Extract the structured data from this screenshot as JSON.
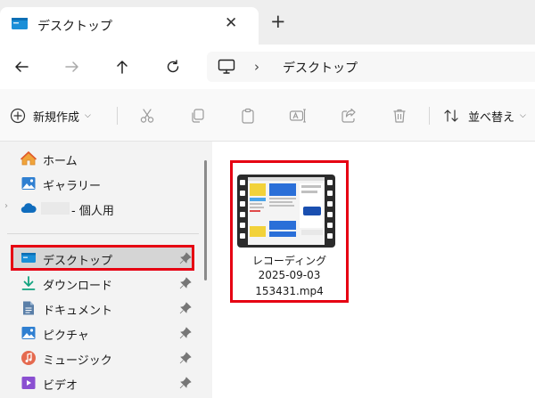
{
  "window": {
    "tab_title": "デスクトップ",
    "close_glyph": "✕",
    "new_tab_glyph": "+"
  },
  "address": {
    "separator": "›",
    "location": "デスクトップ"
  },
  "toolbar": {
    "new_label": "新規作成",
    "new_caret": "⌵",
    "sort_label": "並べ替え",
    "sort_caret": "⌵"
  },
  "sidebar": {
    "items": [
      {
        "label": "ホーム",
        "icon": "home-icon"
      },
      {
        "label": "ギャラリー",
        "icon": "gallery-icon"
      },
      {
        "label": "- 個人用",
        "icon": "onedrive-icon"
      },
      {
        "label": "デスクトップ",
        "icon": "desktop-icon",
        "selected": true
      },
      {
        "label": "ダウンロード",
        "icon": "download-icon"
      },
      {
        "label": "ドキュメント",
        "icon": "document-icon"
      },
      {
        "label": "ピクチャ",
        "icon": "pictures-icon"
      },
      {
        "label": "ミュージック",
        "icon": "music-icon"
      },
      {
        "label": "ビデオ",
        "icon": "video-icon"
      }
    ]
  },
  "files": [
    {
      "name_line1": "レコーディング",
      "name_line2": "2025-09-03",
      "name_line3": "153431.mp4",
      "icon": "video-file-icon"
    }
  ],
  "colors": {
    "highlight": "#e60012",
    "accent": "#0067c0"
  }
}
